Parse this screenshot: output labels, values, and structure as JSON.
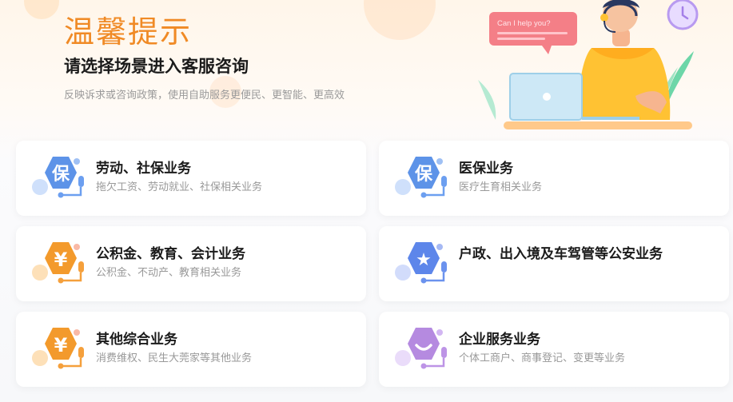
{
  "header": {
    "title": "温馨提示",
    "subtitle": "请选择场景进入客服咨询",
    "description": "反映诉求或咨询政策，使用自助服务更便民、更智能、更高效"
  },
  "illustration": {
    "speech_bubble_text": "Can I help you?"
  },
  "cards": [
    {
      "title": "劳动、社保业务",
      "description": "拖欠工资、劳动就业、社保相关业务",
      "icon": "bao-badge-icon",
      "glyph": "保",
      "color": "#5d93e8"
    },
    {
      "title": "医保业务",
      "description": "医疗生育相关业务",
      "icon": "bao-badge-icon",
      "glyph": "保",
      "color": "#5d93e8"
    },
    {
      "title": "公积金、教育、会计业务",
      "description": "公积金、不动产、教育相关业务",
      "icon": "yen-badge-icon",
      "glyph": "¥",
      "color": "#f39a2c"
    },
    {
      "title": "户政、出入境及车驾管等公安业务",
      "description": "",
      "icon": "star-badge-icon",
      "glyph": "★",
      "color": "#5d86ea"
    },
    {
      "title": "其他综合业务",
      "description": "消费维权、民生大莞家等其他业务",
      "icon": "yen-badge-icon",
      "glyph": "¥",
      "color": "#f39a2c"
    },
    {
      "title": "企业服务业务",
      "description": "个体工商户、商事登记、变更等业务",
      "icon": "smile-badge-icon",
      "glyph": "◡",
      "color": "#b58ae0"
    }
  ]
}
